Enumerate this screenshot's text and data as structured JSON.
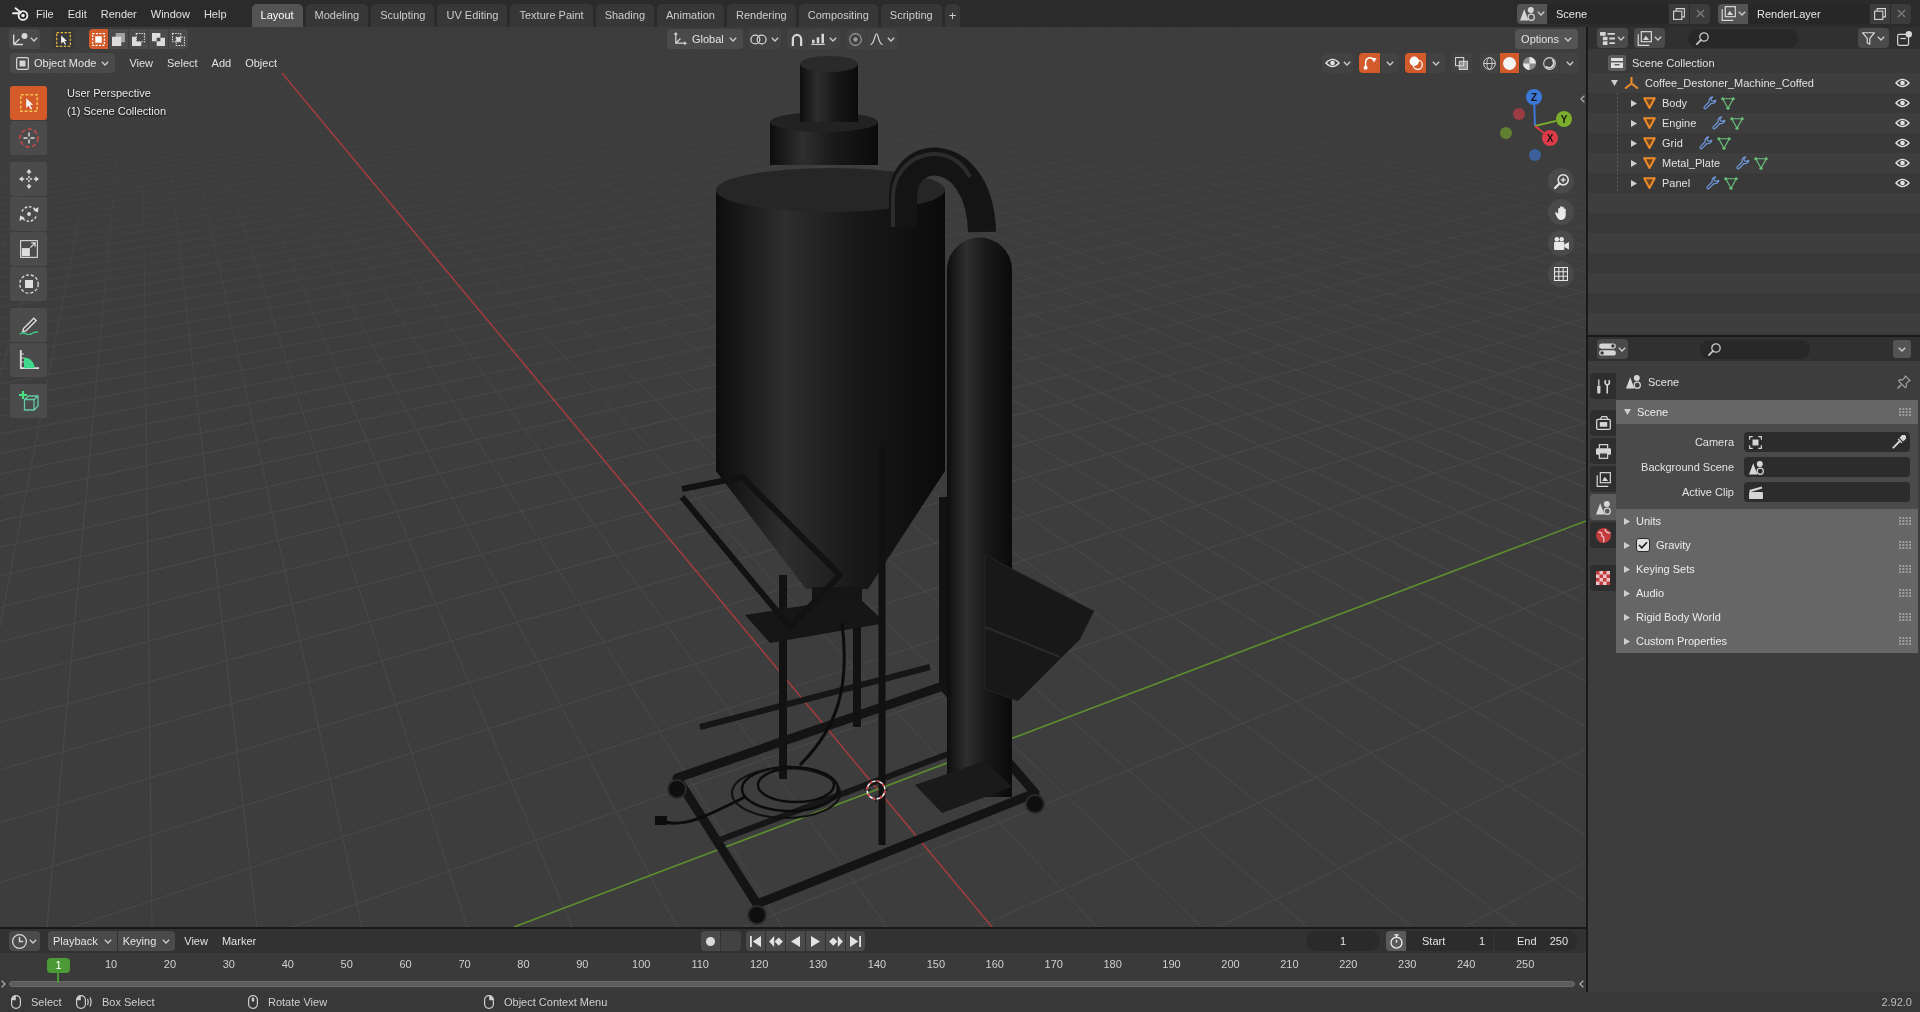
{
  "top_bar": {
    "menus": [
      "File",
      "Edit",
      "Render",
      "Window",
      "Help"
    ],
    "workspaces": [
      {
        "label": "Layout",
        "selected": true
      },
      {
        "label": "Modeling",
        "selected": false
      },
      {
        "label": "Sculpting",
        "selected": false
      },
      {
        "label": "UV Editing",
        "selected": false
      },
      {
        "label": "Texture Paint",
        "selected": false
      },
      {
        "label": "Shading",
        "selected": false
      },
      {
        "label": "Animation",
        "selected": false
      },
      {
        "label": "Rendering",
        "selected": false
      },
      {
        "label": "Compositing",
        "selected": false
      },
      {
        "label": "Scripting",
        "selected": false
      }
    ],
    "add_workspace": "+",
    "scene": "Scene",
    "view_layer": "RenderLayer"
  },
  "tool_header": {
    "select_modes": [
      {
        "kind": "set",
        "selected": true
      },
      {
        "kind": "extend",
        "selected": false
      },
      {
        "kind": "subtract",
        "selected": false
      },
      {
        "kind": "difference",
        "selected": false
      },
      {
        "kind": "intersect",
        "selected": false
      }
    ],
    "orientation": "Global",
    "options": "Options"
  },
  "viewport_header": {
    "mode": "Object Mode",
    "menus": [
      "View",
      "Select",
      "Add",
      "Object"
    ],
    "toggles": [
      {
        "kind": "gizmos",
        "on": true
      },
      {
        "kind": "overlays",
        "on": true
      },
      {
        "kind": "xray",
        "on": false
      }
    ],
    "shading": [
      {
        "kind": "wireframe",
        "selected": false
      },
      {
        "kind": "solid",
        "selected": true
      },
      {
        "kind": "material",
        "selected": false
      },
      {
        "kind": "rendered",
        "selected": false
      }
    ]
  },
  "viewport": {
    "view_name": "User Perspective",
    "collection": "(1) Scene Collection",
    "tool_groups": [
      {
        "tools": [
          {
            "kind": "select_box",
            "selected": true
          },
          {
            "kind": "cursor",
            "selected": false
          }
        ]
      },
      {
        "tools": [
          {
            "kind": "move",
            "selected": false
          },
          {
            "kind": "rotate",
            "selected": false
          },
          {
            "kind": "scale",
            "selected": false
          },
          {
            "kind": "transform",
            "selected": false
          }
        ]
      },
      {
        "tools": [
          {
            "kind": "annotate",
            "selected": false
          },
          {
            "kind": "measure",
            "selected": false
          }
        ]
      },
      {
        "tools": [
          {
            "kind": "add_cube",
            "selected": false
          }
        ]
      }
    ],
    "gizmo_axes": [
      {
        "label": "Z",
        "color": "#3b78d8"
      },
      {
        "label": "Y",
        "color": "#7aae2c"
      },
      {
        "label": "X",
        "color": "#de3b48"
      }
    ]
  },
  "outliner": {
    "root": "Scene Collection",
    "tree": [
      {
        "label": "Coffee_Destoner_Machine_Coffed",
        "kind": "empty",
        "expanded": true,
        "visible": true,
        "children": [
          {
            "label": "Body",
            "kind": "mesh",
            "expanded": false,
            "visible": true
          },
          {
            "label": "Engine",
            "kind": "mesh",
            "expanded": false,
            "visible": true
          },
          {
            "label": "Grid",
            "kind": "mesh",
            "expanded": false,
            "visible": true
          },
          {
            "label": "Metal_Plate",
            "kind": "mesh",
            "expanded": false,
            "visible": true
          },
          {
            "label": "Panel",
            "kind": "mesh",
            "expanded": false,
            "visible": true
          }
        ]
      }
    ]
  },
  "properties": {
    "tabs": [
      {
        "kind": "tool",
        "selected": false
      },
      {
        "kind": "render",
        "selected": false
      },
      {
        "kind": "output",
        "selected": false
      },
      {
        "kind": "view_layer",
        "selected": false
      },
      {
        "kind": "scene",
        "selected": true
      },
      {
        "kind": "world",
        "selected": false
      },
      {
        "kind": "texture",
        "selected": false
      }
    ],
    "context": "Scene",
    "panels": [
      {
        "title": "Scene",
        "kind": "plain",
        "expanded": true,
        "fields": [
          {
            "label": "Camera",
            "kind": "camera"
          },
          {
            "label": "Background Scene",
            "kind": "scene"
          },
          {
            "label": "Active Clip",
            "kind": "clip"
          }
        ]
      },
      {
        "title": "Units",
        "kind": "plain",
        "expanded": false
      },
      {
        "title": "Gravity",
        "kind": "checkbox",
        "expanded": false,
        "checked": true
      },
      {
        "title": "Keying Sets",
        "kind": "plain",
        "expanded": false
      },
      {
        "title": "Audio",
        "kind": "plain",
        "expanded": false
      },
      {
        "title": "Rigid Body World",
        "kind": "plain",
        "expanded": false
      },
      {
        "title": "Custom Properties",
        "kind": "plain",
        "expanded": false
      }
    ]
  },
  "timeline": {
    "dropdowns": [
      "Playback",
      "Keying"
    ],
    "menus": [
      "View",
      "Marker"
    ],
    "current_frame": "1",
    "start_label": "Start",
    "start": "1",
    "end_label": "End",
    "end": "250",
    "playhead": "1",
    "ticks": [
      "10",
      "20",
      "30",
      "40",
      "50",
      "60",
      "70",
      "80",
      "90",
      "100",
      "110",
      "120",
      "130",
      "140",
      "150",
      "160",
      "170",
      "180",
      "190",
      "200",
      "210",
      "220",
      "230",
      "240",
      "250"
    ]
  },
  "status_bar": {
    "hints": [
      {
        "kind": "mouse_left",
        "label": "Select"
      },
      {
        "kind": "mouse_drag",
        "label": "Box Select"
      },
      {
        "kind": "mouse_middle",
        "label": "Rotate View"
      },
      {
        "kind": "mouse_right",
        "label": "Object Context Menu"
      }
    ],
    "version": "2.92.0"
  }
}
